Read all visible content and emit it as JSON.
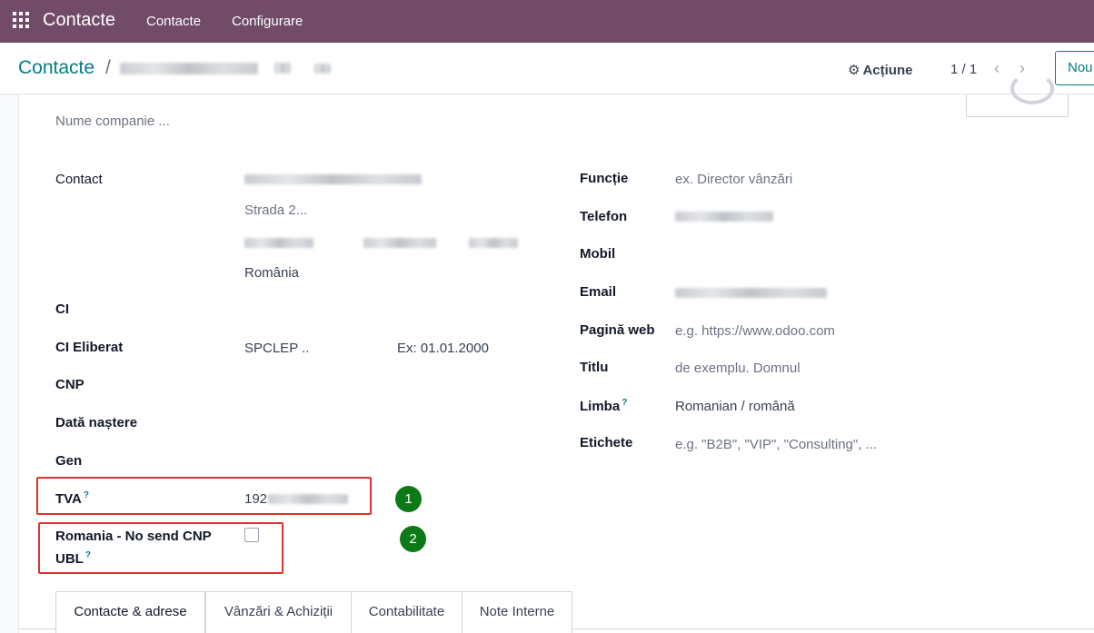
{
  "navbar": {
    "app_name": "Contacte",
    "menu": [
      "Contacte",
      "Configurare"
    ]
  },
  "control_panel": {
    "breadcrumb_root": "Contacte",
    "breadcrumb_sep": "/",
    "action_label": "Acțiune",
    "pager": "1 / 1",
    "new_button": "Nou"
  },
  "form": {
    "company_placeholder": "Nume companie ...",
    "contact_label": "Contact",
    "street2_placeholder": "Strada 2...",
    "country": "România",
    "ci_label": "CI",
    "ci_eliberat_label": "CI Eliberat",
    "ci_eliberat_placeholder": "SPCLEP ..",
    "ci_date_placeholder": "Ex: 01.01.2000",
    "cnp_label": "CNP",
    "birthdate_label": "Dată naștere",
    "gen_label": "Gen",
    "tva_label": "TVA",
    "tva_help": "?",
    "tva_value_visible": "192",
    "no_send_cnp_label_line1": "Romania - No send CNP",
    "no_send_cnp_label_line2": "UBL",
    "no_send_cnp_help": "?",
    "no_send_cnp_checked": false,
    "right": {
      "functie_label": "Funcție",
      "functie_placeholder": "ex. Director vânzări",
      "telefon_label": "Telefon",
      "mobil_label": "Mobil",
      "email_label": "Email",
      "web_label": "Pagină web",
      "web_placeholder": "e.g. https://www.odoo.com",
      "titlu_label": "Titlu",
      "titlu_placeholder": "de exemplu. Domnul",
      "limba_label": "Limba",
      "limba_help": "?",
      "limba_value": "Romanian / română",
      "etichete_label": "Etichete",
      "etichete_placeholder": "e.g. \"B2B\", \"VIP\", \"Consulting\", ..."
    }
  },
  "annotations": {
    "badge1": "1",
    "badge2": "2",
    "highlight_color": "#e03131",
    "badge_color": "#0b7a16"
  },
  "tabs": [
    "Contacte & adrese",
    "Vânzări & Achiziții",
    "Contabilitate",
    "Note Interne"
  ],
  "colors": {
    "navbar": "#714B67",
    "link": "#017e84"
  }
}
